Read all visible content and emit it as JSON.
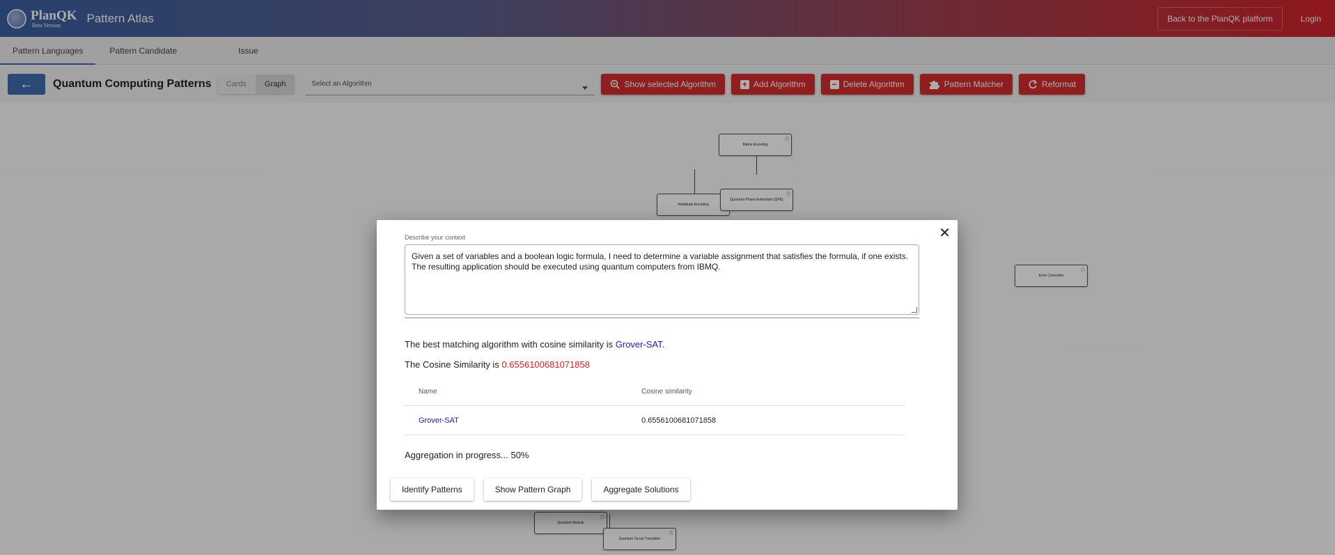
{
  "header": {
    "logo_name": "PlanQK",
    "logo_sub": "Beta Version",
    "app_title": "Pattern Atlas",
    "back_platform": "Back to the PlanQK platform",
    "login": "Login"
  },
  "nav": {
    "tabs": [
      "Pattern Languages",
      "Pattern Candidate",
      "Issue"
    ]
  },
  "toolbar": {
    "back_icon": "←",
    "page_title": "Quantum Computing Patterns",
    "toggle": [
      "Cards",
      "Graph"
    ],
    "select_label": "Select an Algorithm",
    "buttons": [
      "Show selected Algorithm",
      "Add Algorithm",
      "Delete Algorithm",
      "Pattern Matcher",
      "Reformat"
    ]
  },
  "graph": {
    "nodes": [
      "Matrix Encoding",
      "Amplitude Encoding",
      "Quantum Phase Estimation (QPE)",
      "Error Correction",
      "Quantum Module",
      "Quantum Circuit Translator"
    ]
  },
  "modal": {
    "close": "✕",
    "context_label": "Describe your context",
    "context_line1": "Given a set of variables and a boolean logic formula, I need to determine a variable assignment that satisfies the formula, if one exists.",
    "context_line2": "The resulting application should be executed using quantum computers from IBMQ.",
    "best_prefix": "The best matching algorithm with cosine similarity is ",
    "best_algorithm": "Grover-SAT",
    "best_suffix": ".",
    "cos_prefix": "The Cosine Similarity is ",
    "cos_value": "0.6556100681071858",
    "table": {
      "headers": [
        "Name",
        "Cosine similarity"
      ],
      "rows": [
        {
          "name": "Grover-SAT",
          "similarity": "0.6556100681071858"
        }
      ]
    },
    "aggregation": "Aggregation in progress... 50%",
    "buttons": [
      "Identify Patterns",
      "Show Pattern Graph",
      "Aggregate Solutions"
    ]
  }
}
